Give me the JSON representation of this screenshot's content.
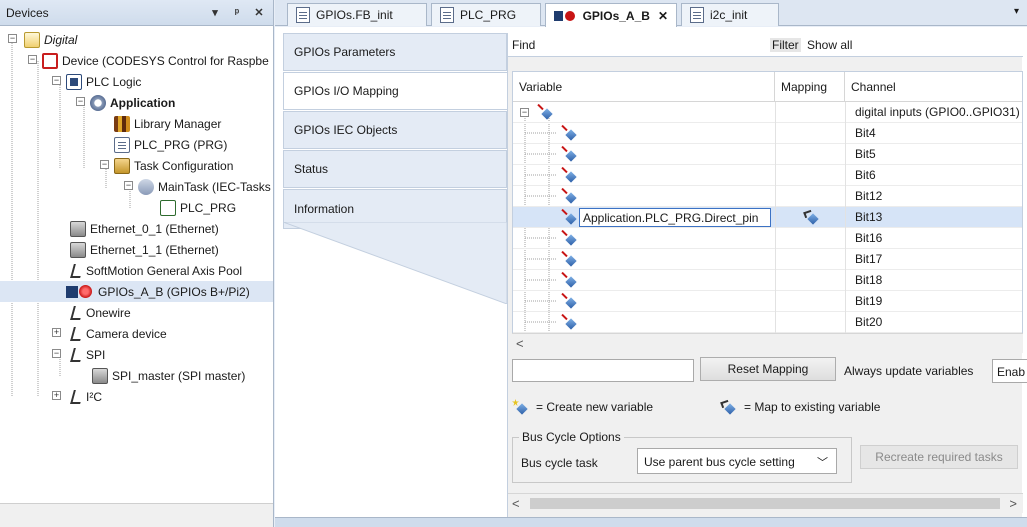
{
  "devices_panel": {
    "title": "Devices",
    "buttons": [
      "▾",
      "ᵖ",
      "✕"
    ],
    "tree": [
      {
        "label": "Digital",
        "style": "italic",
        "icon": "folder-icon",
        "level": 0,
        "expander": "−"
      },
      {
        "label": "Device (CODESYS Control for Raspbe",
        "icon": "device-icon",
        "level": 1,
        "expander": "−"
      },
      {
        "label": "PLC Logic",
        "icon": "plc-logic-icon",
        "level": 2,
        "expander": "−"
      },
      {
        "label": "Application",
        "style": "bold",
        "icon": "application-icon",
        "level": 3,
        "expander": "−"
      },
      {
        "label": "Library Manager",
        "icon": "library-icon",
        "level": 4
      },
      {
        "label": "PLC_PRG (PRG)",
        "icon": "program-icon",
        "level": 4
      },
      {
        "label": "Task Configuration",
        "icon": "task-config-icon",
        "level": 4,
        "expander": "−"
      },
      {
        "label": "MainTask (IEC-Tasks",
        "icon": "maintask-icon",
        "level": 5,
        "expander": "−"
      },
      {
        "label": "PLC_PRG",
        "icon": "program-call-icon",
        "level": 6
      },
      {
        "label": "Ethernet_0_1 (Ethernet)",
        "icon": "ethernet-icon",
        "level": 2
      },
      {
        "label": "Ethernet_1_1 (Ethernet)",
        "icon": "ethernet-icon",
        "level": 2
      },
      {
        "label": "SoftMotion General Axis Pool",
        "icon": "axis-pool-icon",
        "level": 2
      },
      {
        "label": "GPIOs_A_B (GPIOs B+/Pi2)",
        "icon": "gpio-icon",
        "level": 2
      },
      {
        "label": "Onewire",
        "icon": "onewire-icon",
        "level": 2
      },
      {
        "label": "Camera device",
        "icon": "camera-icon",
        "level": 2,
        "expander": "+"
      },
      {
        "label": "SPI",
        "icon": "spi-icon",
        "level": 2,
        "expander": "−"
      },
      {
        "label": "SPI_master (SPI master)",
        "icon": "spi-master-icon",
        "level": 3
      },
      {
        "label": "I²C",
        "icon": "i2c-icon",
        "level": 2,
        "expander": "+"
      }
    ]
  },
  "tabs": [
    {
      "label": "GPIOs.FB_init",
      "icon": "fb-icon"
    },
    {
      "label": "PLC_PRG",
      "icon": "document-icon"
    },
    {
      "label": "GPIOs_A_B",
      "icon": "gpio-icon",
      "active": true,
      "close": "✕"
    },
    {
      "label": "i2c_init",
      "icon": "document-icon"
    }
  ],
  "tabs_overflow": "▾",
  "side_tabs": [
    "GPIOs Parameters",
    "GPIOs I/O Mapping",
    "GPIOs IEC Objects",
    "Status",
    "Information"
  ],
  "find_bar": {
    "find_label": "Find",
    "find_value": "",
    "filter_label": "Filter",
    "filter_value": "Show all"
  },
  "grid": {
    "headers": {
      "variable": "Variable",
      "mapping": "Mapping",
      "channel": "Channel"
    },
    "rows": [
      {
        "variable": "",
        "mapping": "",
        "channel": "digital inputs (GPIO0..GPIO31)",
        "expander": "−"
      },
      {
        "variable": "",
        "mapping": "",
        "channel": "Bit4"
      },
      {
        "variable": "",
        "mapping": "",
        "channel": "Bit5"
      },
      {
        "variable": "",
        "mapping": "",
        "channel": "Bit6"
      },
      {
        "variable": "",
        "mapping": "",
        "channel": "Bit12"
      },
      {
        "variable": "Application.PLC_PRG.Direct_pin",
        "mapping": "map-existing-icon",
        "channel": "Bit13",
        "selected": true
      },
      {
        "variable": "",
        "mapping": "",
        "channel": "Bit16"
      },
      {
        "variable": "",
        "mapping": "",
        "channel": "Bit17"
      },
      {
        "variable": "",
        "mapping": "",
        "channel": "Bit18"
      },
      {
        "variable": "",
        "mapping": "",
        "channel": "Bit19"
      },
      {
        "variable": "",
        "mapping": "",
        "channel": "Bit20"
      }
    ]
  },
  "scroll_left": "<",
  "scroll_right": ">",
  "mapping_bar": {
    "input_value": "",
    "reset_label": "Reset Mapping",
    "always_label": "Always update variables",
    "enable_label": "Enab"
  },
  "legend": {
    "create_new": "= Create new variable",
    "map_existing": "= Map to existing variable"
  },
  "bus_cycle": {
    "group_title": "Bus Cycle Options",
    "label": "Bus cycle task",
    "value": "Use parent bus cycle setting",
    "recreate_label": "Recreate required tasks"
  }
}
